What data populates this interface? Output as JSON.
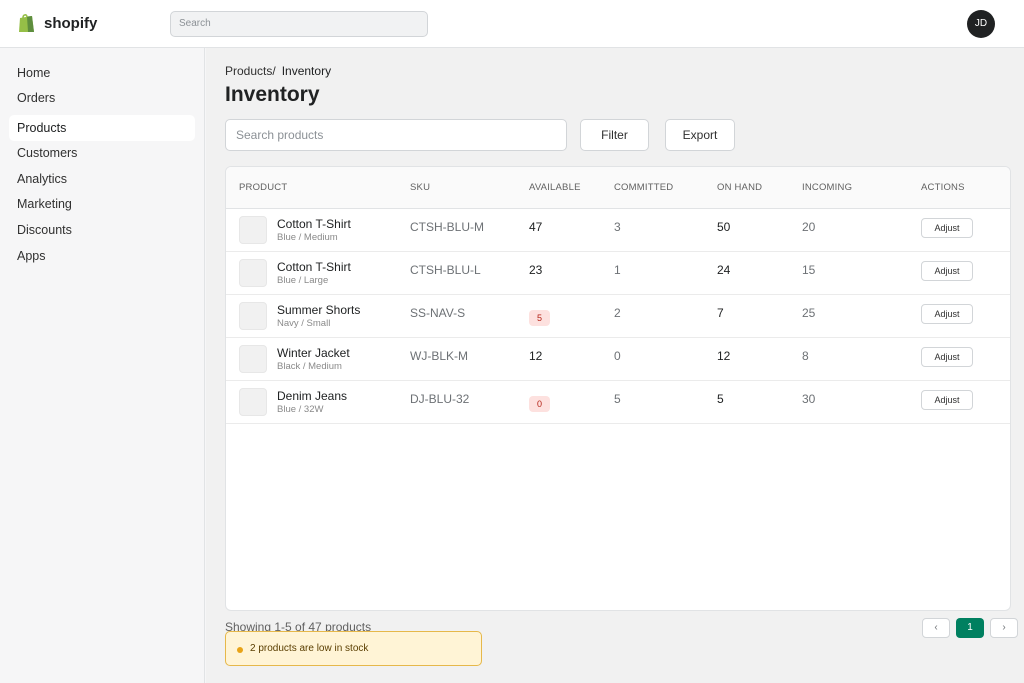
{
  "app": {
    "brand": "shopify"
  },
  "header": {
    "search_placeholder": "Search",
    "avatar_initials": "JD"
  },
  "sidebar": {
    "items": [
      {
        "label": "Home",
        "active": false
      },
      {
        "label": "Orders",
        "active": false
      },
      {
        "label": "Products",
        "active": true
      },
      {
        "label": "Customers",
        "active": false
      },
      {
        "label": "Analytics",
        "active": false
      },
      {
        "label": "Marketing",
        "active": false
      },
      {
        "label": "Discounts",
        "active": false
      },
      {
        "label": "Apps",
        "active": false
      }
    ]
  },
  "main": {
    "breadcrumb": {
      "parent": "Products/",
      "current": "Inventory"
    },
    "title": "Inventory",
    "search_placeholder": "Search products",
    "filter_label": "Filter",
    "export_label": "Export",
    "table": {
      "columns": [
        "PRODUCT",
        "SKU",
        "AVAILABLE",
        "COMMITTED",
        "ON HAND",
        "INCOMING",
        "ACTIONS"
      ],
      "rows": [
        {
          "name": "Cotton T-Shirt",
          "variant": "Blue / Medium",
          "sku": "CTSH-BLU-M",
          "available": "47",
          "low": false,
          "committed": "3",
          "on_hand": "50",
          "incoming": "20",
          "action": "Adjust"
        },
        {
          "name": "Cotton T-Shirt",
          "variant": "Blue / Large",
          "sku": "CTSH-BLU-L",
          "available": "23",
          "low": false,
          "committed": "1",
          "on_hand": "24",
          "incoming": "15",
          "action": "Adjust"
        },
        {
          "name": "Summer Shorts",
          "variant": "Navy / Small",
          "sku": "SS-NAV-S",
          "available": "5",
          "low": true,
          "committed": "2",
          "on_hand": "7",
          "incoming": "25",
          "action": "Adjust"
        },
        {
          "name": "Winter Jacket",
          "variant": "Black / Medium",
          "sku": "WJ-BLK-M",
          "available": "12",
          "low": false,
          "committed": "0",
          "on_hand": "12",
          "incoming": "8",
          "action": "Adjust"
        },
        {
          "name": "Denim Jeans",
          "variant": "Blue / 32W",
          "sku": "DJ-BLU-32",
          "available": "0",
          "low": true,
          "committed": "5",
          "on_hand": "5",
          "incoming": "30",
          "action": "Adjust"
        }
      ]
    },
    "showing_text": "Showing 1-5 of 47 products",
    "pagination": {
      "prev": "‹",
      "current": "1",
      "next": "›"
    },
    "alert": {
      "text": "2 products are low in stock"
    }
  },
  "colors": {
    "brand_green": "#95bf47",
    "primary_button": "#008060",
    "low_stock_bg": "#fde1df",
    "alert_bg": "#fff4d6"
  },
  "icons": {
    "logo": "shopify-bag-icon",
    "prev": "chevron-left-icon",
    "next": "chevron-right-icon"
  }
}
